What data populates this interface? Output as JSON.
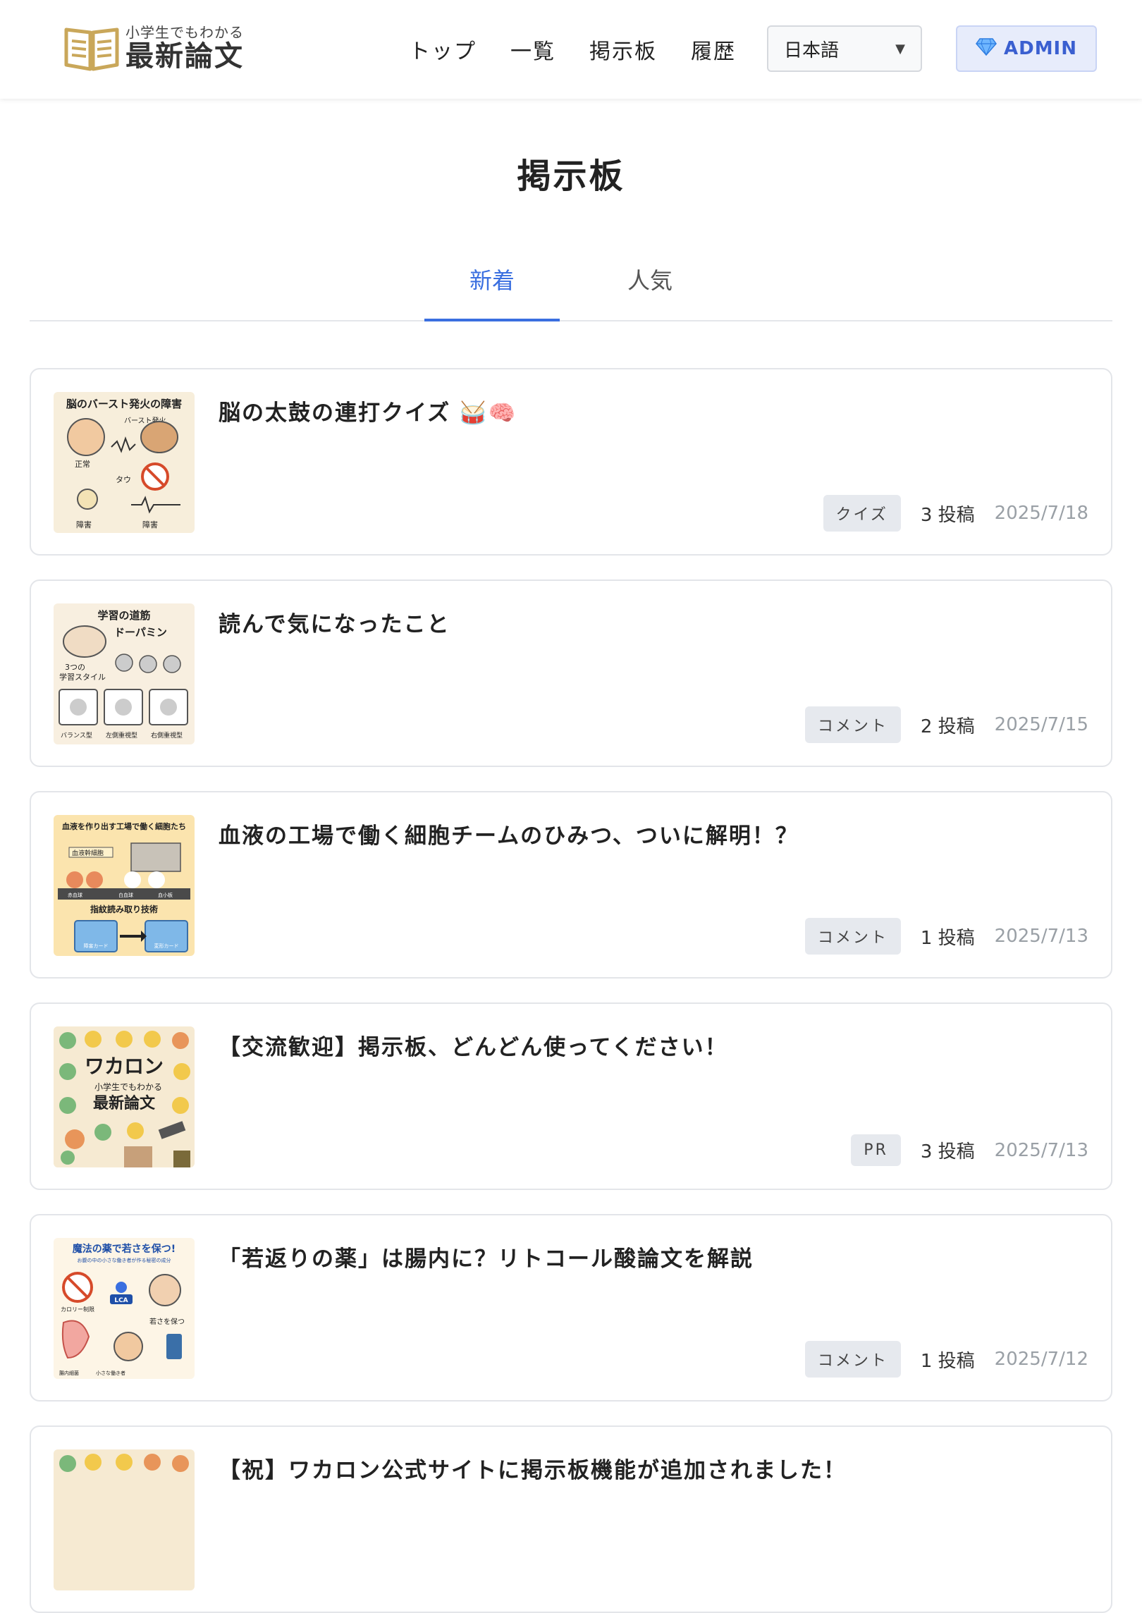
{
  "header": {
    "logo_sub": "小学生でもわかる",
    "logo_main": "最新論文",
    "nav": [
      {
        "label": "トップ"
      },
      {
        "label": "一覧"
      },
      {
        "label": "掲示板"
      },
      {
        "label": "履歴"
      }
    ],
    "language": "日本語",
    "admin_label": "ADMIN"
  },
  "page": {
    "title": "掲示板"
  },
  "tabs": [
    {
      "label": "新着",
      "active": true
    },
    {
      "label": "人気",
      "active": false
    }
  ],
  "posts": [
    {
      "title": "脳の太鼓の連打クイズ 🥁🧠",
      "category": "クイズ",
      "count": "3 投稿",
      "date": "2025/7/18",
      "thumb": {
        "heading": "脳のバースト発火の障害",
        "labels": [
          "バースト発火",
          "正常",
          "タウ",
          "障害",
          "障害"
        ],
        "bg": "#f7eedb"
      }
    },
    {
      "title": "読んで気になったこと",
      "category": "コメント",
      "count": "2 投稿",
      "date": "2025/7/15",
      "thumb": {
        "heading": "学習の道筋",
        "labels": [
          "ドーパミン",
          "3つの",
          "学習スタイル",
          "バランス型",
          "左側重視型",
          "右側重視型"
        ],
        "bg": "#f8efe0"
      }
    },
    {
      "title": "血液の工場で働く細胞チームのひみつ、ついに解明！？",
      "category": "コメント",
      "count": "1 投稿",
      "date": "2025/7/13",
      "thumb": {
        "heading": "血液を作り出す工場で働く細胞たち",
        "labels": [
          "血液幹細胞",
          "赤血球",
          "白血球",
          "血小板",
          "指紋読み取り技術",
          "障害カード",
          "変形カード"
        ],
        "bg": "#fbe4ae"
      }
    },
    {
      "title": "【交流歓迎】掲示板、どんどん使ってください！",
      "category": "PR",
      "count": "3 投稿",
      "date": "2025/7/13",
      "thumb": {
        "heading": "ワカロン",
        "labels": [
          "小学生でもわかる",
          "最新論文"
        ],
        "bg": "#f6ead2"
      }
    },
    {
      "title": "「若返りの薬」は腸内に？リトコール酸論文を解説",
      "category": "コメント",
      "count": "1 投稿",
      "date": "2025/7/12",
      "thumb": {
        "heading": "魔法の薬で若さを保つ!",
        "labels": [
          "お腹の中の小さな働き者が作る秘密の成分",
          "カロリー制限",
          "LCA",
          "若さを保つ",
          "腸内細菌",
          "小さな働き者"
        ],
        "bg": "#fdf5e6"
      }
    },
    {
      "title": "【祝】ワカロン公式サイトに掲示板機能が追加されました！",
      "category": "",
      "count": "",
      "date": "",
      "thumb": {
        "heading": "",
        "labels": [],
        "bg": "#f6ead2"
      }
    }
  ],
  "colors": {
    "accent": "#3a6fe0",
    "badge_bg": "#e6e9ee",
    "date": "#9aa0a6",
    "admin_bg": "#e7ecfb",
    "logo_gold": "#c9a75a"
  },
  "icons": {
    "logo": "open-book-icon",
    "admin": "gem-icon",
    "dropdown": "triangle-down-icon"
  }
}
